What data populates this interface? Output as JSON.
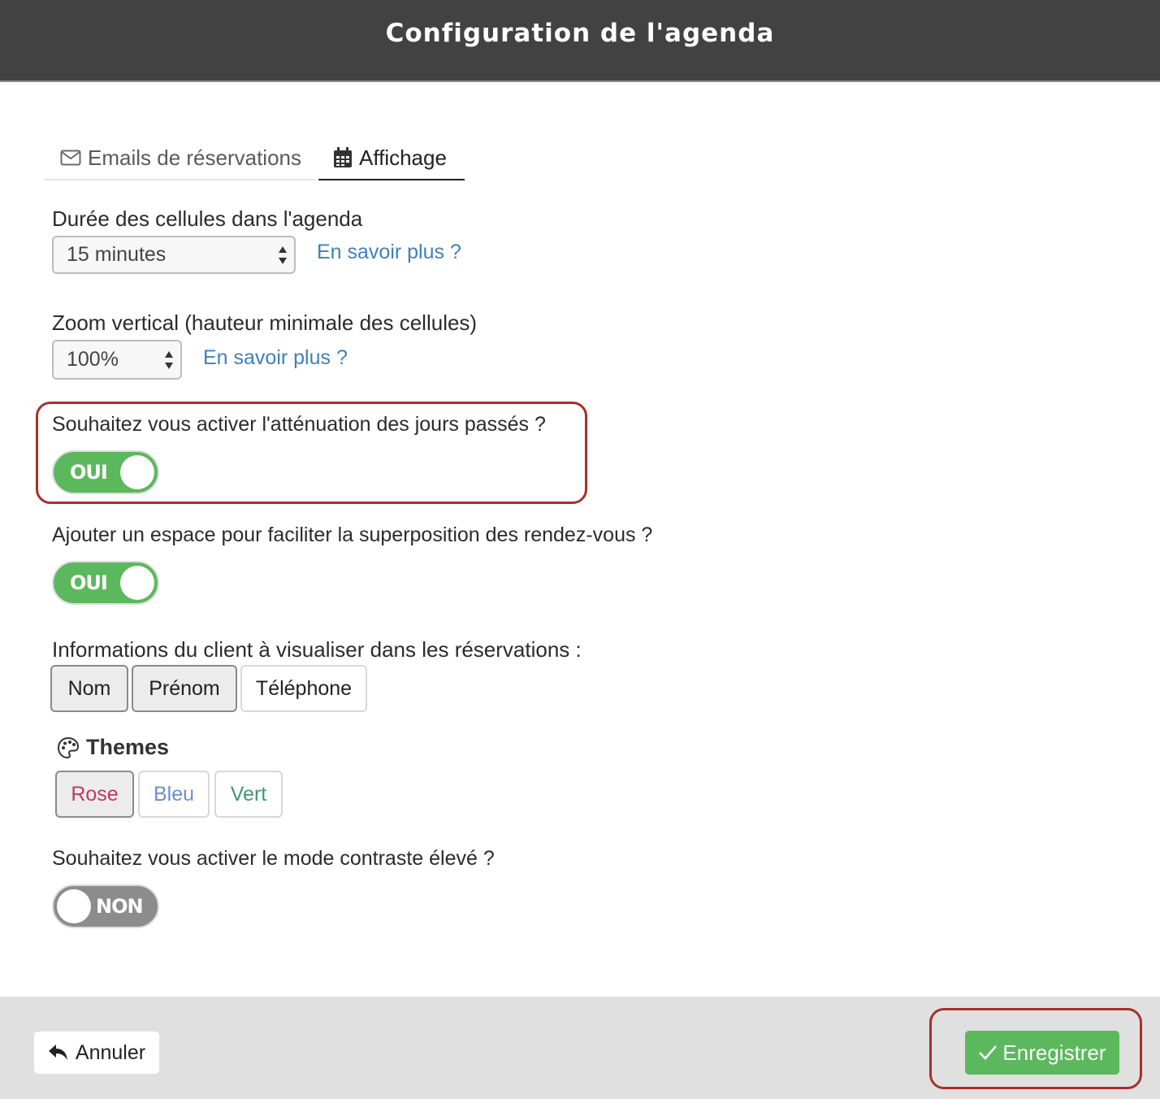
{
  "header": {
    "title": "Configuration de l'agenda"
  },
  "tabs": [
    {
      "label": "Emails de réservations",
      "icon": "envelope-icon",
      "active": false
    },
    {
      "label": "Affichage",
      "icon": "calendar-icon",
      "active": true
    }
  ],
  "cell_duration": {
    "label": "Durée des cellules dans l'agenda",
    "value": "15 minutes",
    "help_link": "En savoir plus ?"
  },
  "vertical_zoom": {
    "label": "Zoom vertical (hauteur minimale des cellules)",
    "value": "100%",
    "help_link": "En savoir plus ?"
  },
  "past_days_dimming": {
    "label": "Souhaitez vous activer l'atténuation des jours passés ?",
    "toggle_text": "OUI",
    "enabled": true
  },
  "overlap_space": {
    "label": "Ajouter un espace pour faciliter la superposition des rendez-vous ?",
    "toggle_text": "OUI",
    "enabled": true
  },
  "client_info": {
    "label": "Informations du client à visualiser dans les réservations :",
    "options": [
      {
        "label": "Nom",
        "selected": true
      },
      {
        "label": "Prénom",
        "selected": true
      },
      {
        "label": "Téléphone",
        "selected": false
      }
    ]
  },
  "themes": {
    "title": "Themes",
    "icon": "palette-icon",
    "options": [
      {
        "label": "Rose",
        "color": "#c0395e",
        "selected": true
      },
      {
        "label": "Bleu",
        "color": "#6a8fd0",
        "selected": false
      },
      {
        "label": "Vert",
        "color": "#3f9a6e",
        "selected": false
      }
    ]
  },
  "high_contrast": {
    "label": "Souhaitez vous activer le mode contraste élevé ?",
    "toggle_text": "NON",
    "enabled": false
  },
  "footer": {
    "cancel_label": "Annuler",
    "cancel_icon": "undo-arrow-icon",
    "save_label": "Enregistrer",
    "save_icon": "check-icon"
  },
  "colors": {
    "header_bg": "#424242",
    "toggle_on": "#5cb85c",
    "toggle_off": "#8c8c8c",
    "link": "#3f7fbf",
    "highlight": "#a8302c",
    "save_button": "#5cb85c"
  }
}
